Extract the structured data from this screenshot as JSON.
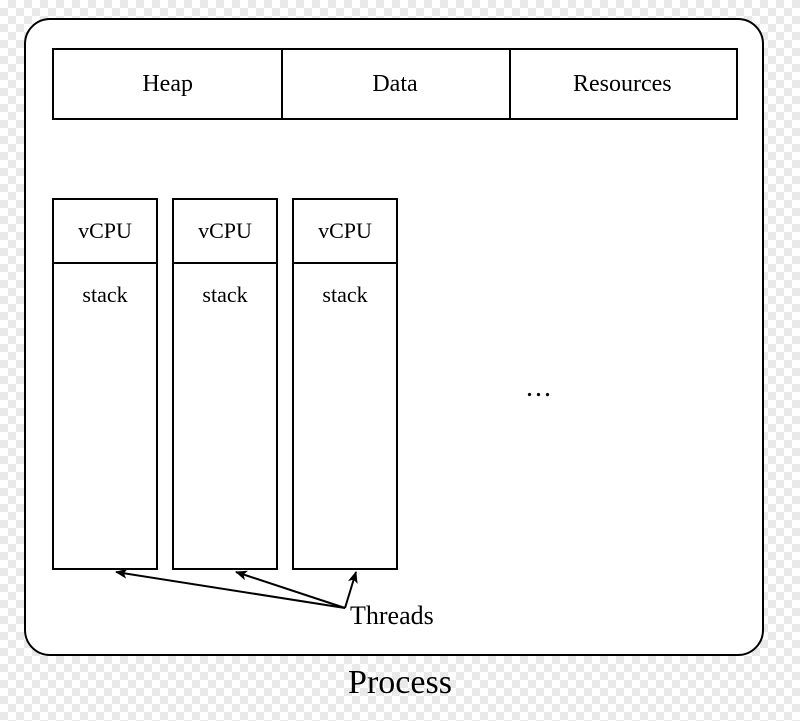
{
  "process_label": "Process",
  "shared": {
    "heap": "Heap",
    "data": "Data",
    "resources": "Resources"
  },
  "threads": [
    {
      "vcpu": "vCPU",
      "stack": "stack"
    },
    {
      "vcpu": "vCPU",
      "stack": "stack"
    },
    {
      "vcpu": "vCPU",
      "stack": "stack"
    }
  ],
  "ellipsis": "...",
  "threads_label": "Threads"
}
